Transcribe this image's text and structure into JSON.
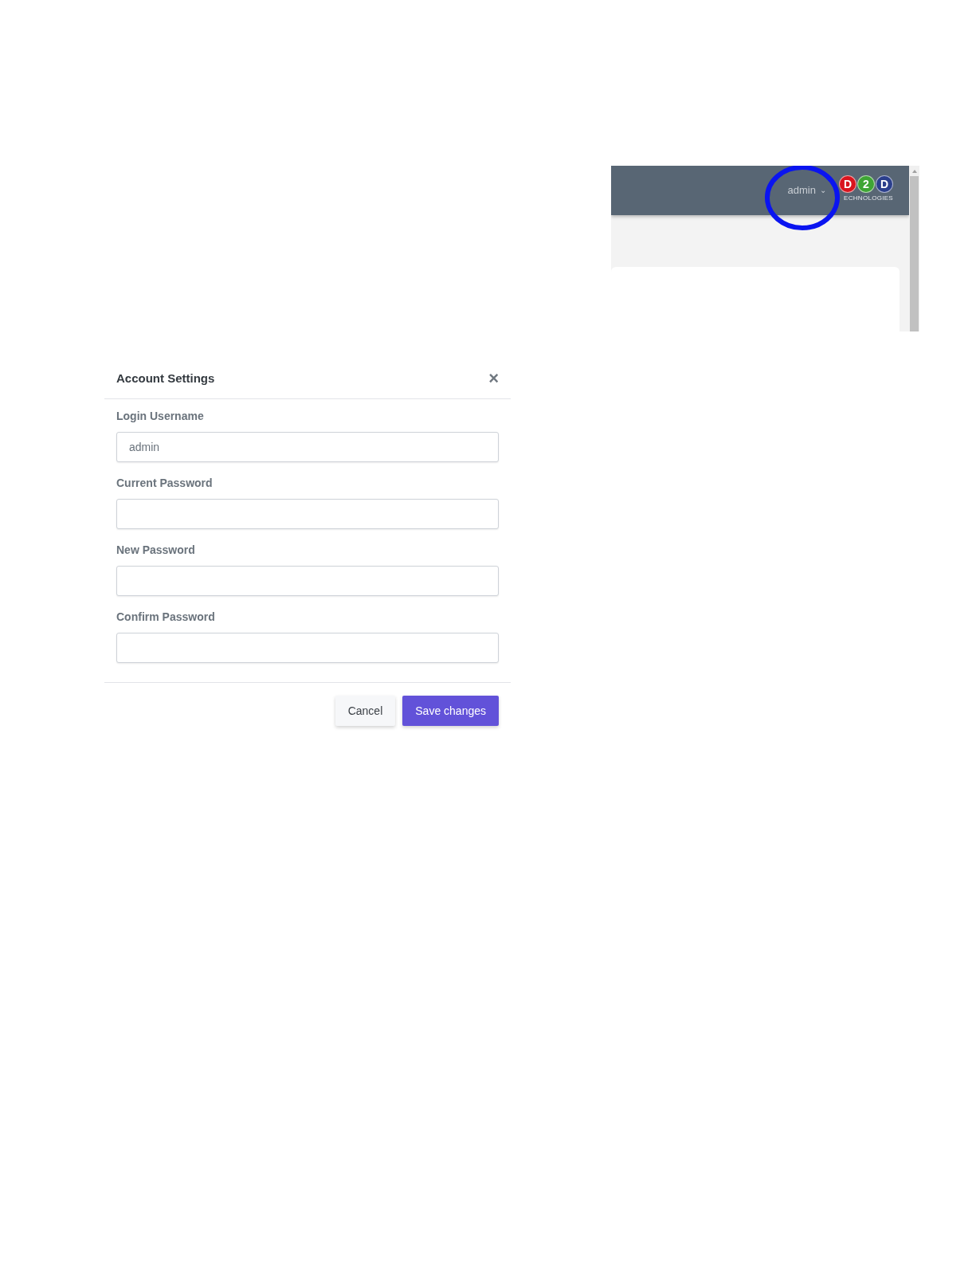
{
  "app_screenshot": {
    "header": {
      "user_menu": {
        "label": "admin",
        "caret": "⌄"
      },
      "logo": {
        "letters": [
          "D",
          "2",
          "D"
        ],
        "tagline": "ECHNOLOGIES"
      }
    },
    "annotation": {
      "kind": "circle",
      "color": "#0a14f0"
    }
  },
  "dialog": {
    "title": "Account Settings",
    "close": "×",
    "fields": [
      {
        "label": "Login Username",
        "value": "admin"
      },
      {
        "label": "Current Password"
      },
      {
        "label": "New Password"
      },
      {
        "label": "Confirm Password"
      }
    ],
    "buttons": [
      {
        "label": "Cancel",
        "kind": "secondary"
      },
      {
        "label": "Save changes",
        "kind": "primary"
      }
    ]
  }
}
